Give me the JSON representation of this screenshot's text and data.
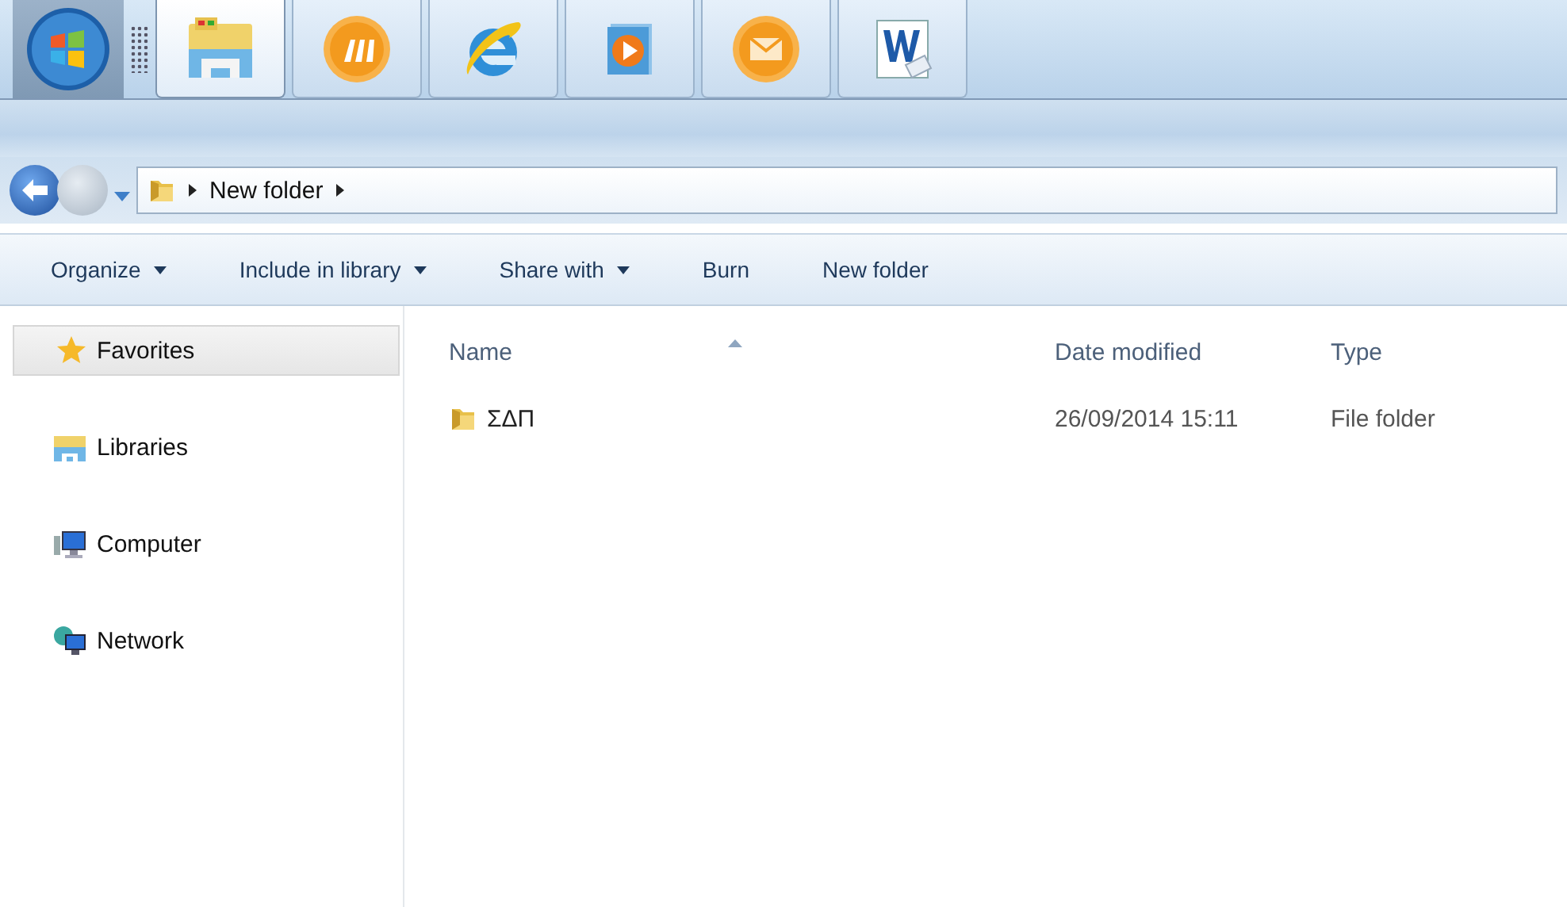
{
  "taskbar": {
    "items": [
      {
        "kind": "start",
        "active": false
      },
      {
        "kind": "explorer",
        "active": true
      },
      {
        "kind": "orange-app",
        "active": false
      },
      {
        "kind": "browser",
        "active": false
      },
      {
        "kind": "media",
        "active": false
      },
      {
        "kind": "mail",
        "active": false
      },
      {
        "kind": "word",
        "active": false
      }
    ]
  },
  "address": {
    "path": [
      {
        "label": "New folder"
      }
    ]
  },
  "toolbar": [
    {
      "label": "Organize",
      "dropdown": true
    },
    {
      "label": "Include in library",
      "dropdown": true
    },
    {
      "label": "Share with",
      "dropdown": true
    },
    {
      "label": "Burn",
      "dropdown": false
    },
    {
      "label": "New folder",
      "dropdown": false
    }
  ],
  "sidebar": [
    {
      "label": "Favorites",
      "kind": "favorites",
      "selected": true
    },
    {
      "label": "Libraries",
      "kind": "libraries",
      "selected": false
    },
    {
      "label": "Computer",
      "kind": "computer",
      "selected": false
    },
    {
      "label": "Network",
      "kind": "network",
      "selected": false
    }
  ],
  "columns": [
    {
      "label": "Name",
      "sorted": true
    },
    {
      "label": "Date modified",
      "sorted": false
    },
    {
      "label": "Type",
      "sorted": false
    }
  ],
  "files": [
    {
      "name": "ΣΔΠ",
      "date_modified": "26/09/2014 15:11",
      "type": "File folder"
    }
  ]
}
